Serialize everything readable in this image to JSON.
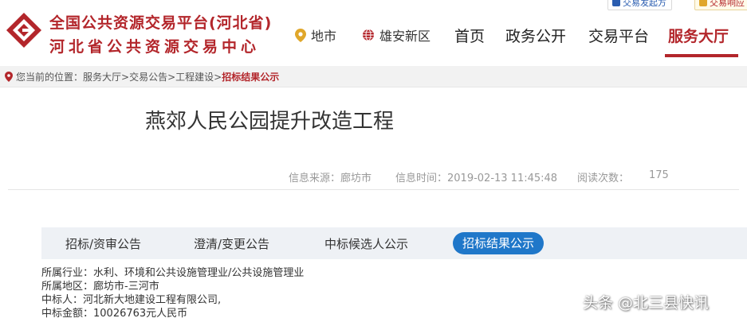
{
  "colors": {
    "brand_red": "#b3262b",
    "tab_active_blue": "#1f77c9",
    "tab_bar_bg": "#eef1f5"
  },
  "header": {
    "brand_line1": "全国公共资源交易平台(河北省)",
    "brand_line2": "河北省公共资源交易中心",
    "logo_icon": "provincial-trading-logo",
    "top_buttons": [
      {
        "label": "交易发起方"
      },
      {
        "label": "交易响应"
      }
    ],
    "locations": [
      {
        "label": "地市",
        "icon": "map-pin-icon"
      },
      {
        "label": "雄安新区",
        "icon": "globe-icon"
      }
    ],
    "nav": [
      {
        "label": "首页"
      },
      {
        "label": "政务公开"
      },
      {
        "label": "交易平台"
      },
      {
        "label": "服务大厅",
        "active": true
      }
    ]
  },
  "breadcrumb": {
    "prefix": "您当前的位置：",
    "path": "服务大厅>交易公告>工程建设>",
    "current": "招标结果公示"
  },
  "article": {
    "title": "燕郊人民公园提升改造工程",
    "source": "信息来源：廊坊市",
    "time": "信息时间：2019-02-13 11:45:48",
    "views_label": "阅读次数：",
    "views": "175"
  },
  "tabs": [
    {
      "label": "招标/资审公告"
    },
    {
      "label": "澄清/变更公告"
    },
    {
      "label": "中标候选人公示"
    },
    {
      "label": "招标结果公示",
      "active": true
    }
  ],
  "info": {
    "industry": "所属行业：水利、环境和公共设施管理业/公共设施管理业",
    "region": "所属地区：廊坊市-三河市",
    "winner": "中标人：河北新大地建设工程有限公司,",
    "amount": "中标金额：10026763元人民币"
  },
  "watermark": "头条 @北三县快讯"
}
